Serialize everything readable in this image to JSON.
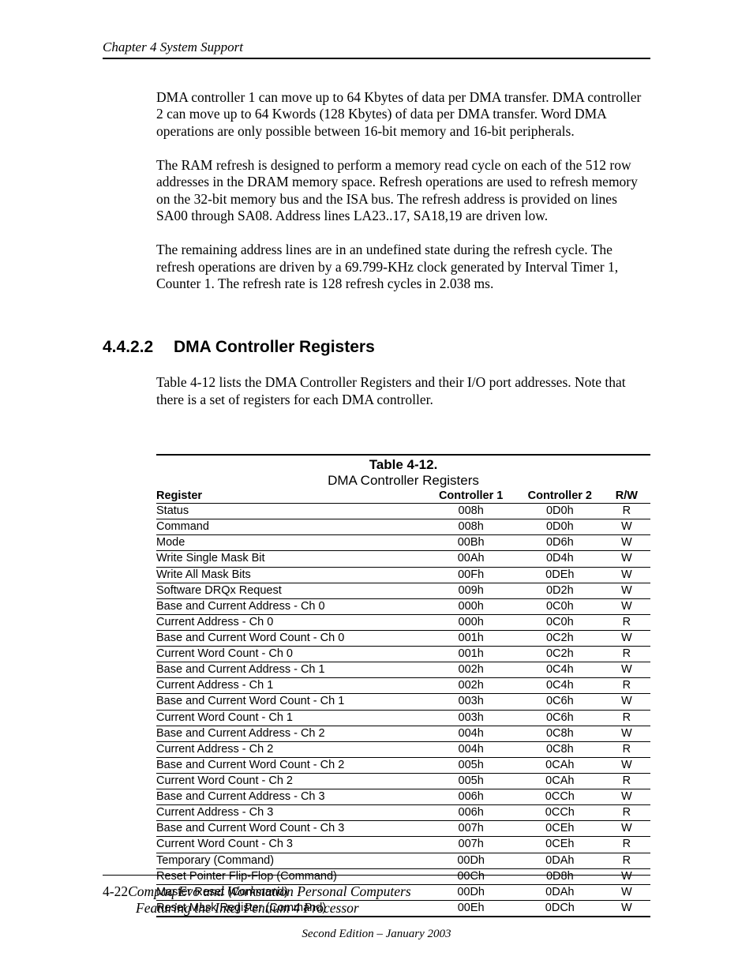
{
  "header": {
    "running": "Chapter 4  System Support"
  },
  "paragraphs": {
    "p1": "DMA controller 1 can move up to 64 Kbytes of data per DMA transfer. DMA controller 2 can move up to 64 Kwords (128 Kbytes) of data per DMA transfer. Word DMA operations are only possible between 16-bit memory and 16-bit peripherals.",
    "p2": "The RAM refresh is designed to perform a memory read cycle on each of the 512 row addresses in the DRAM memory space. Refresh operations are used to refresh memory on the 32-bit memory bus and the ISA bus. The refresh address is provided on lines SA00 through SA08. Address lines LA23..17, SA18,19 are driven low.",
    "p3": "The remaining address lines are in an undefined state during the refresh cycle. The refresh operations are driven by a 69.799-KHz clock generated by Interval Timer 1, Counter 1. The refresh rate is 128 refresh cycles in 2.038 ms.",
    "p4": "Table 4-12 lists the DMA Controller Registers and their I/O port addresses. Note that there is a set of registers for each DMA controller."
  },
  "section": {
    "number": "4.4.2.2",
    "title": "DMA Controller Registers"
  },
  "table": {
    "number": "Table 4-12.",
    "title": "DMA Controller Registers",
    "headers": {
      "h1": "Register",
      "h2": "Controller 1",
      "h3": "Controller 2",
      "h4": "R/W"
    },
    "rows": [
      {
        "r": "Status",
        "c1": "008h",
        "c2": "0D0h",
        "rw": "R"
      },
      {
        "r": "Command",
        "c1": "008h",
        "c2": "0D0h",
        "rw": "W"
      },
      {
        "r": "Mode",
        "c1": "00Bh",
        "c2": "0D6h",
        "rw": "W"
      },
      {
        "r": "Write Single Mask Bit",
        "c1": "00Ah",
        "c2": "0D4h",
        "rw": "W"
      },
      {
        "r": "Write All Mask Bits",
        "c1": "00Fh",
        "c2": "0DEh",
        "rw": "W"
      },
      {
        "r": "Software DRQx Request",
        "c1": "009h",
        "c2": "0D2h",
        "rw": "W"
      },
      {
        "r": "Base and Current Address - Ch 0",
        "c1": "000h",
        "c2": "0C0h",
        "rw": "W"
      },
      {
        "r": "Current Address - Ch 0",
        "c1": "000h",
        "c2": "0C0h",
        "rw": "R"
      },
      {
        "r": "Base and Current Word Count - Ch 0",
        "c1": "001h",
        "c2": "0C2h",
        "rw": "W"
      },
      {
        "r": "Current Word Count - Ch 0",
        "c1": "001h",
        "c2": "0C2h",
        "rw": "R"
      },
      {
        "r": "Base and Current Address - Ch 1",
        "c1": "002h",
        "c2": "0C4h",
        "rw": "W"
      },
      {
        "r": "Current Address - Ch 1",
        "c1": "002h",
        "c2": "0C4h",
        "rw": "R"
      },
      {
        "r": "Base and Current Word Count - Ch 1",
        "c1": "003h",
        "c2": "0C6h",
        "rw": "W"
      },
      {
        "r": "Current Word Count - Ch 1",
        "c1": "003h",
        "c2": "0C6h",
        "rw": "R"
      },
      {
        "r": "Base and Current Address - Ch 2",
        "c1": "004h",
        "c2": "0C8h",
        "rw": "W"
      },
      {
        "r": "Current Address - Ch 2",
        "c1": "004h",
        "c2": "0C8h",
        "rw": "R"
      },
      {
        "r": "Base and Current Word Count - Ch 2",
        "c1": "005h",
        "c2": "0CAh",
        "rw": "W"
      },
      {
        "r": "Current Word Count - Ch 2",
        "c1": "005h",
        "c2": "0CAh",
        "rw": "R"
      },
      {
        "r": "Base and Current Address - Ch 3",
        "c1": "006h",
        "c2": "0CCh",
        "rw": "W"
      },
      {
        "r": "Current Address - Ch 3",
        "c1": "006h",
        "c2": "0CCh",
        "rw": "R"
      },
      {
        "r": "Base and Current Word Count - Ch 3",
        "c1": "007h",
        "c2": "0CEh",
        "rw": "W"
      },
      {
        "r": "Current Word Count - Ch 3",
        "c1": "007h",
        "c2": "0CEh",
        "rw": "R"
      },
      {
        "r": "Temporary (Command)",
        "c1": "00Dh",
        "c2": "0DAh",
        "rw": "R"
      },
      {
        "r": "Reset Pointer Flip-Flop (Command)",
        "c1": "00Ch",
        "c2": "0D8h",
        "rw": "W"
      },
      {
        "r": "Master Reset (Command)",
        "c1": "00Dh",
        "c2": "0DAh",
        "rw": "W"
      },
      {
        "r": "Reset Mask Register (Command)",
        "c1": "00Eh",
        "c2": "0DCh",
        "rw": "W"
      }
    ]
  },
  "footer": {
    "page": "4-22",
    "title1": "Compaq Evo and Workstation Personal Computers",
    "title2": "Featuring the Intel Pentium 4 Processor",
    "edition": "Second Edition – January 2003"
  }
}
